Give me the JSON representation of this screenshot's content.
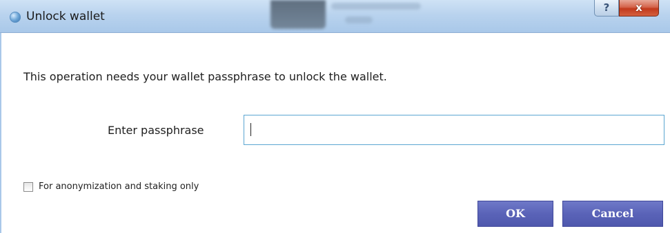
{
  "window": {
    "title": "Unlock wallet",
    "help_label": "?",
    "close_label": "x"
  },
  "dialog": {
    "message": "This operation needs your wallet passphrase to unlock the wallet.",
    "passphrase_label": "Enter passphrase",
    "passphrase_value": "",
    "passphrase_placeholder": "",
    "checkbox_label": "For anonymization and staking only",
    "checkbox_checked": false,
    "ok_label": "OK",
    "cancel_label": "Cancel"
  },
  "colors": {
    "button_bg": "#5a63b8",
    "input_border": "#5aa5d1",
    "titlebar": "#b9d3ee",
    "close_button": "#c2391c"
  },
  "icons": {
    "app": "wallet-app-icon",
    "help": "help-icon",
    "close": "close-icon"
  }
}
